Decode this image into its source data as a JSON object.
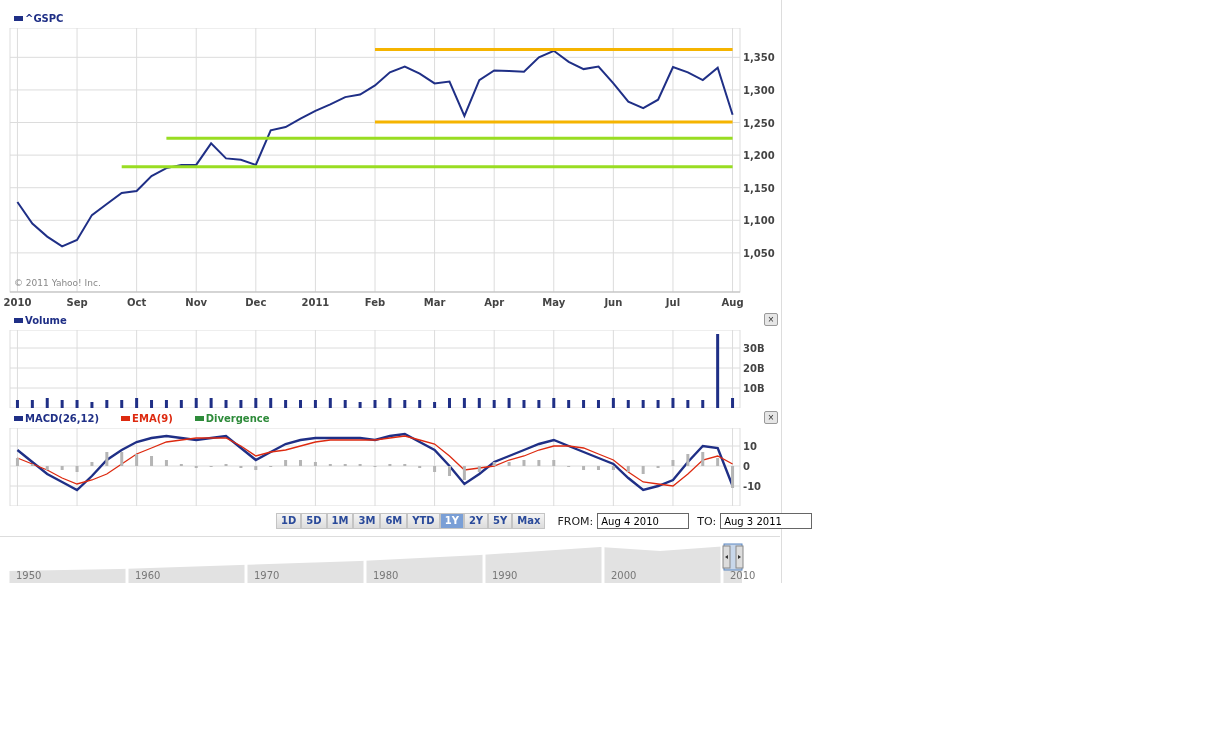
{
  "price_panel": {
    "copyright": "© 2011 Yahoo! Inc.",
    "chart_data": {
      "type": "line",
      "ylim": [
        990,
        1395
      ],
      "grid": true,
      "categories": [
        "2010",
        null,
        null,
        null,
        "Sep",
        null,
        null,
        null,
        "Oct",
        null,
        null,
        null,
        "Nov",
        null,
        null,
        null,
        "Dec",
        null,
        null,
        null,
        "2011",
        null,
        null,
        null,
        "Feb",
        null,
        null,
        null,
        "Mar",
        null,
        null,
        null,
        "Apr",
        null,
        null,
        null,
        "May",
        null,
        null,
        null,
        "Jun",
        null,
        null,
        null,
        "Jul",
        null,
        null,
        null,
        "Aug"
      ],
      "yticks": [
        {
          "value": 1050,
          "label": "1,050"
        },
        {
          "value": 1100,
          "label": "1,100"
        },
        {
          "value": 1150,
          "label": "1,150"
        },
        {
          "value": 1200,
          "label": "1,200"
        },
        {
          "value": 1250,
          "label": "1,250"
        },
        {
          "value": 1300,
          "label": "1,300"
        },
        {
          "value": 1350,
          "label": "1,350"
        }
      ],
      "series": [
        {
          "name": "^GSPC",
          "color": "#1f2f86",
          "values": [
            1128,
            1095,
            1075,
            1060,
            1070,
            1108,
            1125,
            1142,
            1145,
            1168,
            1180,
            1185,
            1185,
            1218,
            1195,
            1193,
            1185,
            1238,
            1243,
            1256,
            1268,
            1278,
            1289,
            1293,
            1307,
            1327,
            1336,
            1325,
            1310,
            1313,
            1260,
            1315,
            1330,
            1329,
            1328,
            1350,
            1360,
            1343,
            1332,
            1336,
            1310,
            1282,
            1272,
            1285,
            1335,
            1327,
            1315,
            1334,
            1262
          ]
        },
        {
          "color": "#f5b400",
          "values": [
            null,
            null,
            null,
            null,
            null,
            null,
            null,
            null,
            null,
            null,
            null,
            null,
            null,
            null,
            null,
            null,
            null,
            null,
            null,
            null,
            null,
            null,
            null,
            null,
            1362,
            1362,
            1362,
            1362,
            1362,
            1362,
            1362,
            1362,
            1362,
            1362,
            1362,
            1362,
            1362,
            1362,
            1362,
            1362,
            1362,
            1362,
            1362,
            1362,
            1362,
            1362,
            1362,
            1362,
            1362
          ]
        },
        {
          "color": "#f5b400",
          "values": [
            null,
            null,
            null,
            null,
            null,
            null,
            null,
            null,
            null,
            null,
            null,
            null,
            null,
            null,
            null,
            null,
            null,
            null,
            null,
            null,
            null,
            null,
            null,
            null,
            1251,
            1251,
            1251,
            1251,
            1251,
            1251,
            1251,
            1251,
            1251,
            1251,
            1251,
            1251,
            1251,
            1251,
            1251,
            1251,
            1251,
            1251,
            1251,
            1251,
            1251,
            1251,
            1251,
            1251,
            1251
          ]
        },
        {
          "color": "#99dd22",
          "values": [
            null,
            null,
            null,
            null,
            null,
            null,
            null,
            null,
            null,
            null,
            1226,
            1226,
            1226,
            1226,
            1226,
            1226,
            1226,
            1226,
            1226,
            1226,
            1226,
            1226,
            1226,
            1226,
            1226,
            1226,
            1226,
            1226,
            1226,
            1226,
            1226,
            1226,
            1226,
            1226,
            1226,
            1226,
            1226,
            1226,
            1226,
            1226,
            1226,
            1226,
            1226,
            1226,
            1226,
            1226,
            1226,
            1226,
            1226
          ]
        },
        {
          "color": "#99dd22",
          "values": [
            null,
            null,
            null,
            null,
            null,
            null,
            null,
            1182,
            1182,
            1182,
            1182,
            1182,
            1182,
            1182,
            1182,
            1182,
            1182,
            1182,
            1182,
            1182,
            1182,
            1182,
            1182,
            1182,
            1182,
            1182,
            1182,
            1182,
            1182,
            1182,
            1182,
            1182,
            1182,
            1182,
            1182,
            1182,
            1182,
            1182,
            1182,
            1182,
            1182,
            1182,
            1182,
            1182,
            1182,
            1182,
            1182,
            1182,
            1182
          ]
        }
      ]
    }
  },
  "volume_panel": {
    "close": "×",
    "chart_data": {
      "type": "bar",
      "ylim": [
        0,
        39
      ],
      "grid": true,
      "categories": [
        null,
        null,
        null,
        null,
        null,
        null,
        null,
        null,
        null,
        null,
        null,
        null,
        null,
        null,
        null,
        null,
        null,
        null,
        null,
        null,
        null,
        null,
        null,
        null,
        null,
        null,
        null,
        null,
        null,
        null,
        null,
        null,
        null,
        null,
        null,
        null,
        null,
        null,
        null,
        null,
        null,
        null,
        null,
        null,
        null,
        null,
        null,
        null,
        null
      ],
      "yticks": [
        {
          "value": 10,
          "label": "10B"
        },
        {
          "value": 20,
          "label": "20B"
        },
        {
          "value": 30,
          "label": "30B"
        }
      ],
      "series": [
        {
          "name": "Volume",
          "color": "#1f2f86",
          "values": [
            4,
            4,
            5,
            4,
            4,
            3,
            4,
            4,
            5,
            4,
            4,
            4,
            5,
            5,
            4,
            4,
            5,
            5,
            4,
            4,
            4,
            5,
            4,
            3,
            4,
            5,
            4,
            4,
            3,
            5,
            5,
            5,
            4,
            5,
            4,
            4,
            5,
            4,
            4,
            4,
            5,
            4,
            4,
            4,
            5,
            4,
            4,
            37,
            5
          ]
        }
      ]
    }
  },
  "macd_panel": {
    "close": "×",
    "legend": [
      {
        "color": "#1f2f86"
      },
      {
        "color": "#dd2a10"
      },
      {
        "color": "#2e8b3a"
      }
    ],
    "chart_data": {
      "type": "line",
      "ylim": [
        -20,
        19
      ],
      "grid": true,
      "categories": [
        null,
        null,
        null,
        null,
        null,
        null,
        null,
        null,
        null,
        null,
        null,
        null,
        null,
        null,
        null,
        null,
        null,
        null,
        null,
        null,
        null,
        null,
        null,
        null,
        null,
        null,
        null,
        null,
        null,
        null,
        null,
        null,
        null,
        null,
        null,
        null,
        null,
        null,
        null,
        null,
        null,
        null,
        null,
        null,
        null,
        null,
        null,
        null,
        null
      ],
      "yticks": [
        {
          "value": -10,
          "label": "-10"
        },
        {
          "value": 0,
          "label": "0"
        },
        {
          "value": 10,
          "label": "10"
        }
      ],
      "series": [
        {
          "name": "MACD(26,12)",
          "color": "#1f2f86",
          "values": [
            8,
            2,
            -4,
            -8,
            -12,
            -5,
            3,
            8,
            12,
            14,
            15,
            14,
            13,
            14,
            15,
            9,
            3,
            7,
            11,
            13,
            14,
            14,
            14,
            14,
            13,
            15,
            16,
            12,
            8,
            0,
            -9,
            -4,
            2,
            5,
            8,
            11,
            13,
            10,
            7,
            4,
            1,
            -6,
            -12,
            -10,
            -7,
            2,
            10,
            9,
            -10
          ]
        },
        {
          "name": "EMA(9)",
          "color": "#dd2a10",
          "values": [
            4,
            1,
            -2,
            -6,
            -9,
            -7,
            -4,
            1,
            6,
            9,
            12,
            13,
            14,
            14,
            14,
            10,
            5,
            7,
            8,
            10,
            12,
            13,
            13,
            13,
            13,
            14,
            15,
            13,
            11,
            5,
            -2,
            -1,
            0,
            3,
            5,
            8,
            10,
            10,
            9,
            6,
            3,
            -3,
            -8,
            -9,
            -10,
            -4,
            3,
            5,
            1
          ]
        },
        {
          "name": "Divergence",
          "type": "bar",
          "color": "#b5b5b5",
          "values": [
            4,
            1,
            -2,
            -2,
            -3,
            2,
            7,
            7,
            6,
            5,
            3,
            1,
            -1,
            0,
            1,
            -1,
            -2,
            0,
            3,
            3,
            2,
            1,
            1,
            1,
            0,
            1,
            1,
            -1,
            -3,
            -5,
            -7,
            -3,
            2,
            2,
            3,
            3,
            3,
            0,
            -2,
            -2,
            -2,
            -3,
            -4,
            -1,
            3,
            6,
            7,
            4,
            -11
          ]
        }
      ]
    }
  },
  "range_buttons": [
    {
      "label": "1D",
      "selected": false
    },
    {
      "label": "5D",
      "selected": false
    },
    {
      "label": "1M",
      "selected": false
    },
    {
      "label": "3M",
      "selected": false
    },
    {
      "label": "6M",
      "selected": false
    },
    {
      "label": "YTD",
      "selected": false
    },
    {
      "label": "1Y",
      "selected": true
    },
    {
      "label": "2Y",
      "selected": false
    },
    {
      "label": "5Y",
      "selected": false
    },
    {
      "label": "Max",
      "selected": false
    }
  ],
  "date_from": {
    "label": "FROM:",
    "value": "Aug 4 2010"
  },
  "date_to": {
    "label": "TO:",
    "value": "Aug 3 2011"
  },
  "navigator": {
    "labels": [
      "1950",
      "1960",
      "1970",
      "1980",
      "1990",
      "2000",
      "2010"
    ]
  }
}
